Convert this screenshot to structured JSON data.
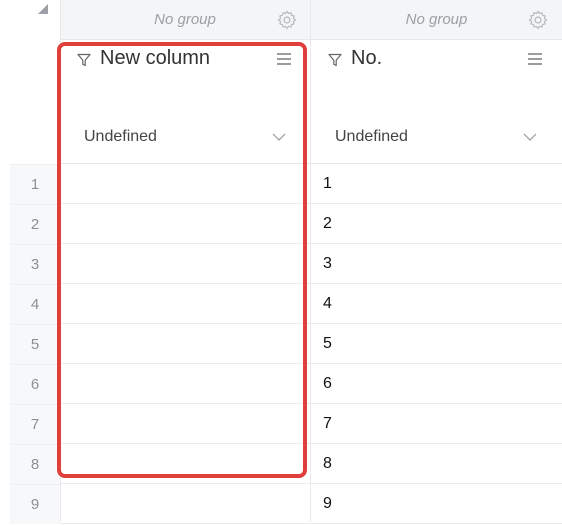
{
  "groups": [
    {
      "label": "No group"
    },
    {
      "label": "No group"
    }
  ],
  "columns": [
    {
      "title": "New column",
      "type": "Undefined",
      "cells": [
        "",
        "",
        "",
        "",
        "",
        "",
        "",
        "",
        ""
      ]
    },
    {
      "title": "No.",
      "type": "Undefined",
      "cells": [
        "1",
        "2",
        "3",
        "4",
        "5",
        "6",
        "7",
        "8",
        "9"
      ]
    }
  ],
  "row_numbers": [
    "1",
    "2",
    "3",
    "4",
    "5",
    "6",
    "7",
    "8",
    "9"
  ],
  "colors": {
    "highlight": "#e0403b",
    "header_bg": "#f4f5f7",
    "muted_text": "#9aa0a6"
  },
  "icons": [
    "select-all-icon",
    "gear-icon",
    "filter-icon",
    "menu-icon",
    "chevron-down-icon"
  ]
}
